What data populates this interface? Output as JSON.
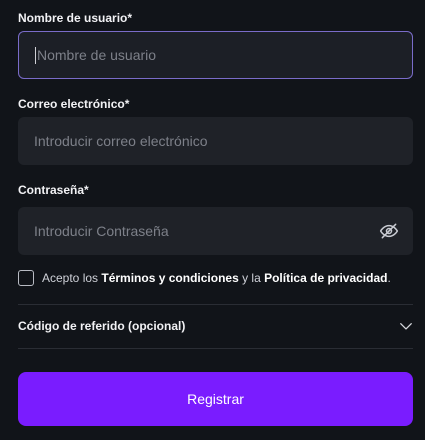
{
  "username": {
    "label": "Nombre de usuario*",
    "placeholder": "Nombre de usuario",
    "value": ""
  },
  "email": {
    "label": "Correo electrónico*",
    "placeholder": "Introducir correo electrónico",
    "value": ""
  },
  "password": {
    "label": "Contraseña*",
    "placeholder": "Introducir Contraseña",
    "value": "",
    "toggle_icon": "eye-off-icon"
  },
  "terms": {
    "prefix": "Acepto los ",
    "terms_link": "Términos y condiciones",
    "middle": " y la ",
    "privacy_link": "Política de privacidad",
    "suffix": "."
  },
  "referral": {
    "label": "Código de referido (opcional)",
    "icon": "chevron-down-icon"
  },
  "submit": {
    "label": "Registrar"
  },
  "colors": {
    "background": "#111419",
    "field": "#1f2228",
    "focus_border": "#7a6cc9",
    "accent": "#7a1cff"
  }
}
